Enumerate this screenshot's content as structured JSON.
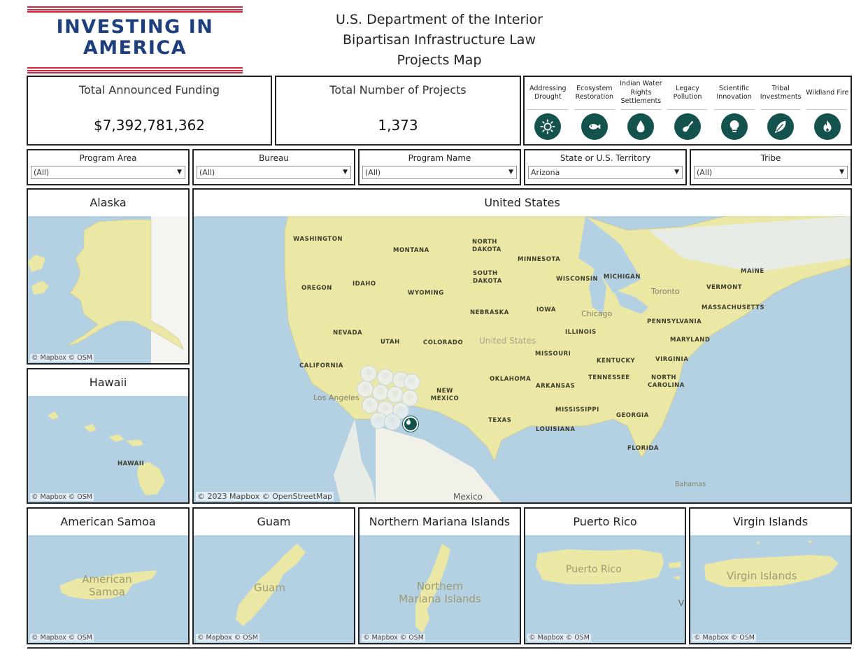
{
  "logo": {
    "line1": "INVESTING IN",
    "line2": "AMERICA"
  },
  "title": {
    "line1": "U.S. Department of the Interior",
    "line2": "Bipartisan Infrastructure Law",
    "line3": "Projects Map"
  },
  "kpis": {
    "funding": {
      "label": "Total Announced Funding",
      "value": "$7,392,781,362"
    },
    "projects": {
      "label": "Total Number of  Projects",
      "value": "1,373"
    }
  },
  "legend": {
    "icon_bg": "#14534d",
    "items": [
      {
        "label": "Addressing Drought",
        "icon": "sun-icon"
      },
      {
        "label": "Ecosystem Restoration",
        "icon": "fish-icon"
      },
      {
        "label": "Indian Water Rights Settlements",
        "icon": "water-drop-icon"
      },
      {
        "label": "Legacy Pollution",
        "icon": "shovel-icon"
      },
      {
        "label": "Scientific Innovation",
        "icon": "lightbulb-icon"
      },
      {
        "label": "Tribal Investments",
        "icon": "feather-icon"
      },
      {
        "label": "Wildland Fire",
        "icon": "fire-icon"
      }
    ]
  },
  "filters": [
    {
      "label": "Program Area",
      "value": "(All)"
    },
    {
      "label": "Bureau",
      "value": "(All)"
    },
    {
      "label": "Program Name",
      "value": "(All)"
    },
    {
      "label": "State or U.S. Territory",
      "value": "Arizona"
    },
    {
      "label": "Tribe",
      "value": "(All)"
    }
  ],
  "maps": {
    "attribution_short": "© Mapbox  © OSM",
    "attribution_long": "© 2023 Mapbox  © OpenStreetMap",
    "water_color": "#b4d0e3",
    "land_color": "#ebe8a6",
    "alaska": {
      "title": "Alaska"
    },
    "hawaii": {
      "title": "Hawaii",
      "label": "HAWAII"
    },
    "us": {
      "title": "United States",
      "country_label": "United States",
      "states": [
        "WASHINGTON",
        "MONTANA",
        "NORTH DAKOTA",
        "MINNESOTA",
        "OREGON",
        "IDAHO",
        "WYOMING",
        "SOUTH DAKOTA",
        "WISCONSIN",
        "MICHIGAN",
        "MAINE",
        "VERMONT",
        "NEBRASKA",
        "IOWA",
        "MASSACHUSETTS",
        "NEVADA",
        "UTAH",
        "COLORADO",
        "ILLINOIS",
        "PENNSYLVANIA",
        "MARYLAND",
        "CALIFORNIA",
        "MISSOURI",
        "KENTUCKY",
        "VIRGINIA",
        "OKLAHOMA",
        "TENNESSEE",
        "NORTH CAROLINA",
        "ARKANSAS",
        "NEW MEXICO",
        "MISSISSIPPI",
        "GEORGIA",
        "TEXAS",
        "LOUISIANA",
        "FLORIDA"
      ],
      "places": [
        "Toronto",
        "Chicago",
        "Los Angeles",
        "Mexico",
        "Bahamas"
      ]
    },
    "american_samoa": {
      "title": "American Samoa",
      "label": "American Samoa"
    },
    "guam": {
      "title": "Guam",
      "label": "Guam"
    },
    "northern_mariana": {
      "title": "Northern Mariana Islands",
      "label": "Northern Mariana Islands"
    },
    "puerto_rico": {
      "title": "Puerto Rico",
      "label": "Puerto Rico",
      "edge_letter": "V"
    },
    "virgin_islands": {
      "title": "Virgin Islands",
      "label": "Virgin Islands"
    }
  }
}
